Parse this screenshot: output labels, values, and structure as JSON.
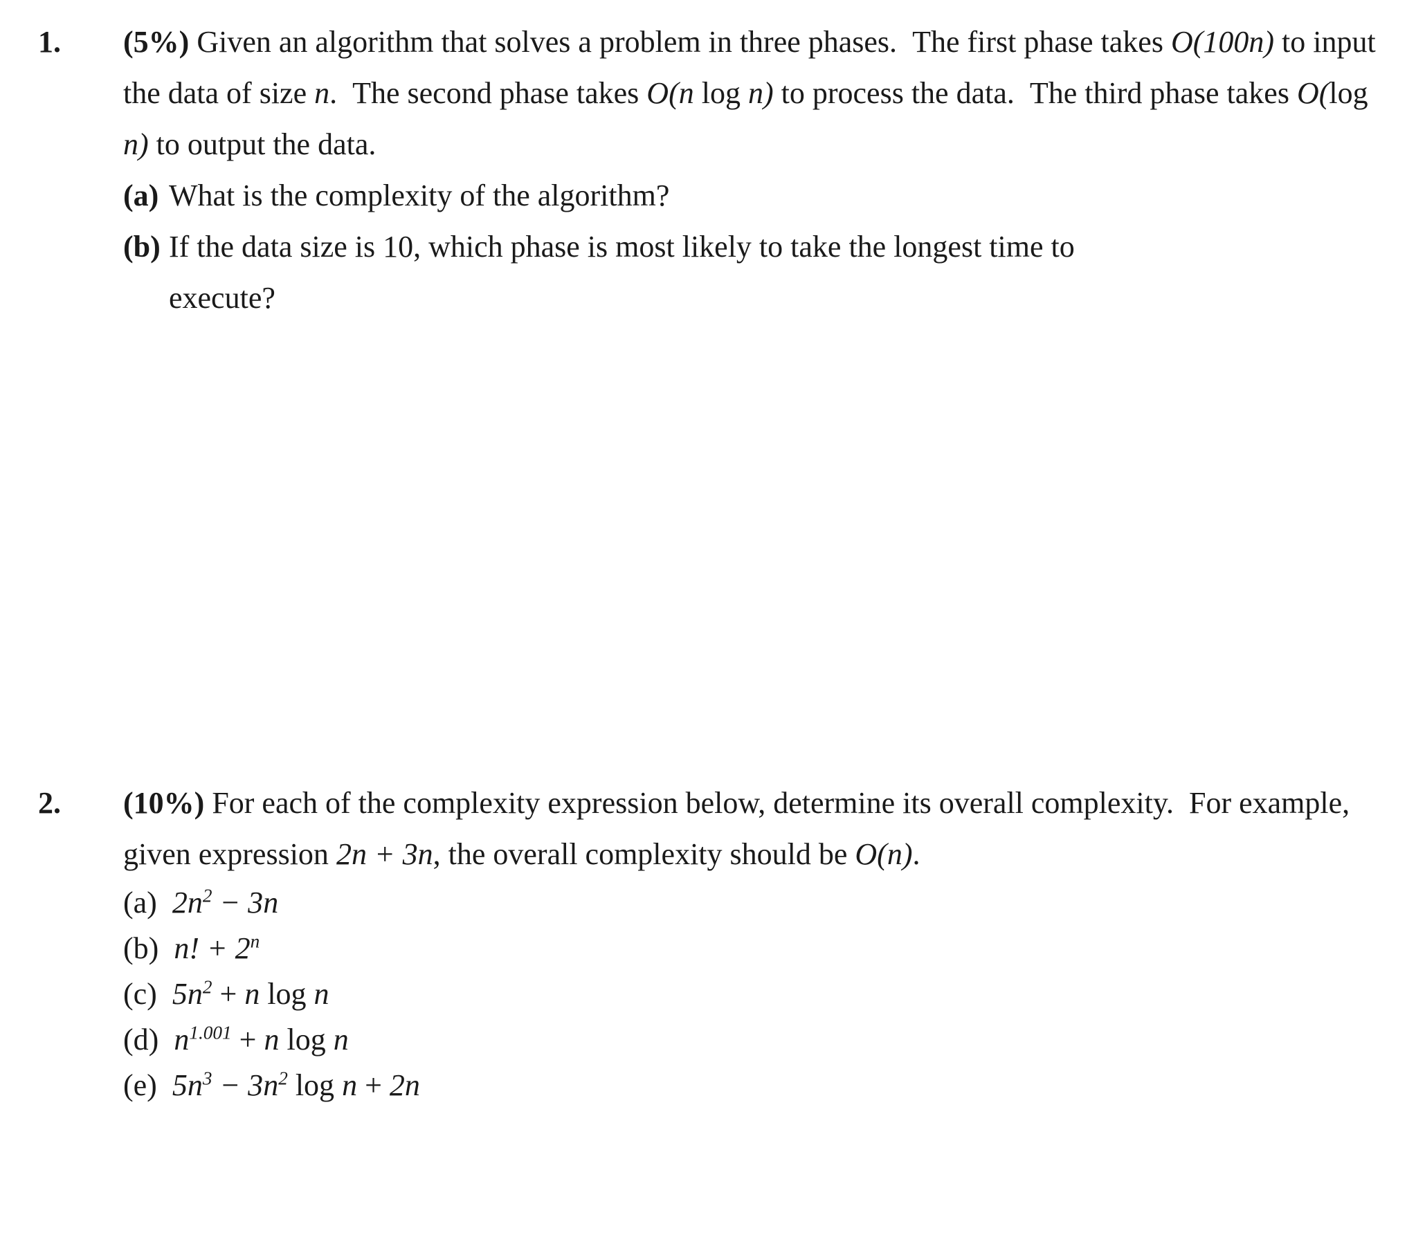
{
  "document": {
    "type": "exam-worksheet",
    "background_color": "#ffffff",
    "text_color": "#1a1a1a"
  },
  "questions": [
    {
      "number": "1.",
      "points": "(5%)",
      "paragraph_lines": [
        "Given an algorithm that solves a problem in three phases.",
        "The first phase takes O(100n) to input the data of size n.",
        "The second phase takes O(n log n) to process the data.",
        "The third phase takes O(log n) to output the data."
      ],
      "paragraph_parts": {
        "line1_a": "Given an algorithm that solves a problem in three phases.",
        "line1_b": "The first phase",
        "line2_a": "takes",
        "line2_math1": "O(100n)",
        "line2_b": "to input the data of size",
        "line2_var": "n",
        "line2_dot": ".",
        "line2_c": "The second phase takes",
        "line2_math2_O": "O(",
        "line2_math2_n1": "n",
        "line2_math2_log": "log",
        "line2_math2_n2": "n)",
        "line2_d": "to",
        "line3_a": "process the data.",
        "line3_b": "The third phase takes",
        "line3_math_O": "O(",
        "line3_math_log": "log",
        "line3_math_n": "n)",
        "line3_c": "to output the data."
      },
      "subitems": [
        {
          "marker": "(a)",
          "text": "What is the complexity of the algorithm?"
        },
        {
          "marker": "(b)",
          "text": "If the data size is 10, which phase is most likely to take the longest time to",
          "continuation": "execute?"
        }
      ]
    },
    {
      "number": "2.",
      "points": "(10%)",
      "paragraph_parts": {
        "line1": "For each of the complexity expression below, determine its overall",
        "line2_a": "complexity.",
        "line2_b": "For example, given expression",
        "line2_math": "2n + 3n",
        "line2_c": ", the overall complexity",
        "line3_a": "should be",
        "line3_math": "O(n)",
        "line3_b": "."
      },
      "expressions": [
        {
          "marker": "(a)",
          "parts": [
            {
              "t": "2n",
              "style": "italic"
            },
            {
              "t": "2",
              "style": "sup"
            },
            {
              "t": " − 3n",
              "style": "italic"
            }
          ],
          "plain": "2n² − 3n"
        },
        {
          "marker": "(b)",
          "parts": [
            {
              "t": "n! + 2",
              "style": "italic"
            },
            {
              "t": "n",
              "style": "sup-italic"
            }
          ],
          "plain": "n! + 2ⁿ"
        },
        {
          "marker": "(c)",
          "parts": [
            {
              "t": "5n",
              "style": "italic"
            },
            {
              "t": "2",
              "style": "sup"
            },
            {
              "t": " + ",
              "style": "roman"
            },
            {
              "t": "n",
              "style": "italic"
            },
            {
              "t": " log ",
              "style": "roman"
            },
            {
              "t": "n",
              "style": "italic"
            }
          ],
          "plain": "5n² + n log n"
        },
        {
          "marker": "(d)",
          "parts": [
            {
              "t": "n",
              "style": "italic"
            },
            {
              "t": "1.001",
              "style": "sup-italic"
            },
            {
              "t": " + ",
              "style": "roman"
            },
            {
              "t": "n",
              "style": "italic"
            },
            {
              "t": " log ",
              "style": "roman"
            },
            {
              "t": "n",
              "style": "italic"
            }
          ],
          "plain": "n^1.001 + n log n"
        },
        {
          "marker": "(e)",
          "parts": [
            {
              "t": "5n",
              "style": "italic"
            },
            {
              "t": "3",
              "style": "sup"
            },
            {
              "t": " − 3n",
              "style": "italic"
            },
            {
              "t": "2",
              "style": "sup"
            },
            {
              "t": " log ",
              "style": "roman"
            },
            {
              "t": "n",
              "style": "italic"
            },
            {
              "t": " + 2n",
              "style": "mixed"
            }
          ],
          "plain": "5n³ − 3n² log n + 2n"
        }
      ]
    }
  ]
}
